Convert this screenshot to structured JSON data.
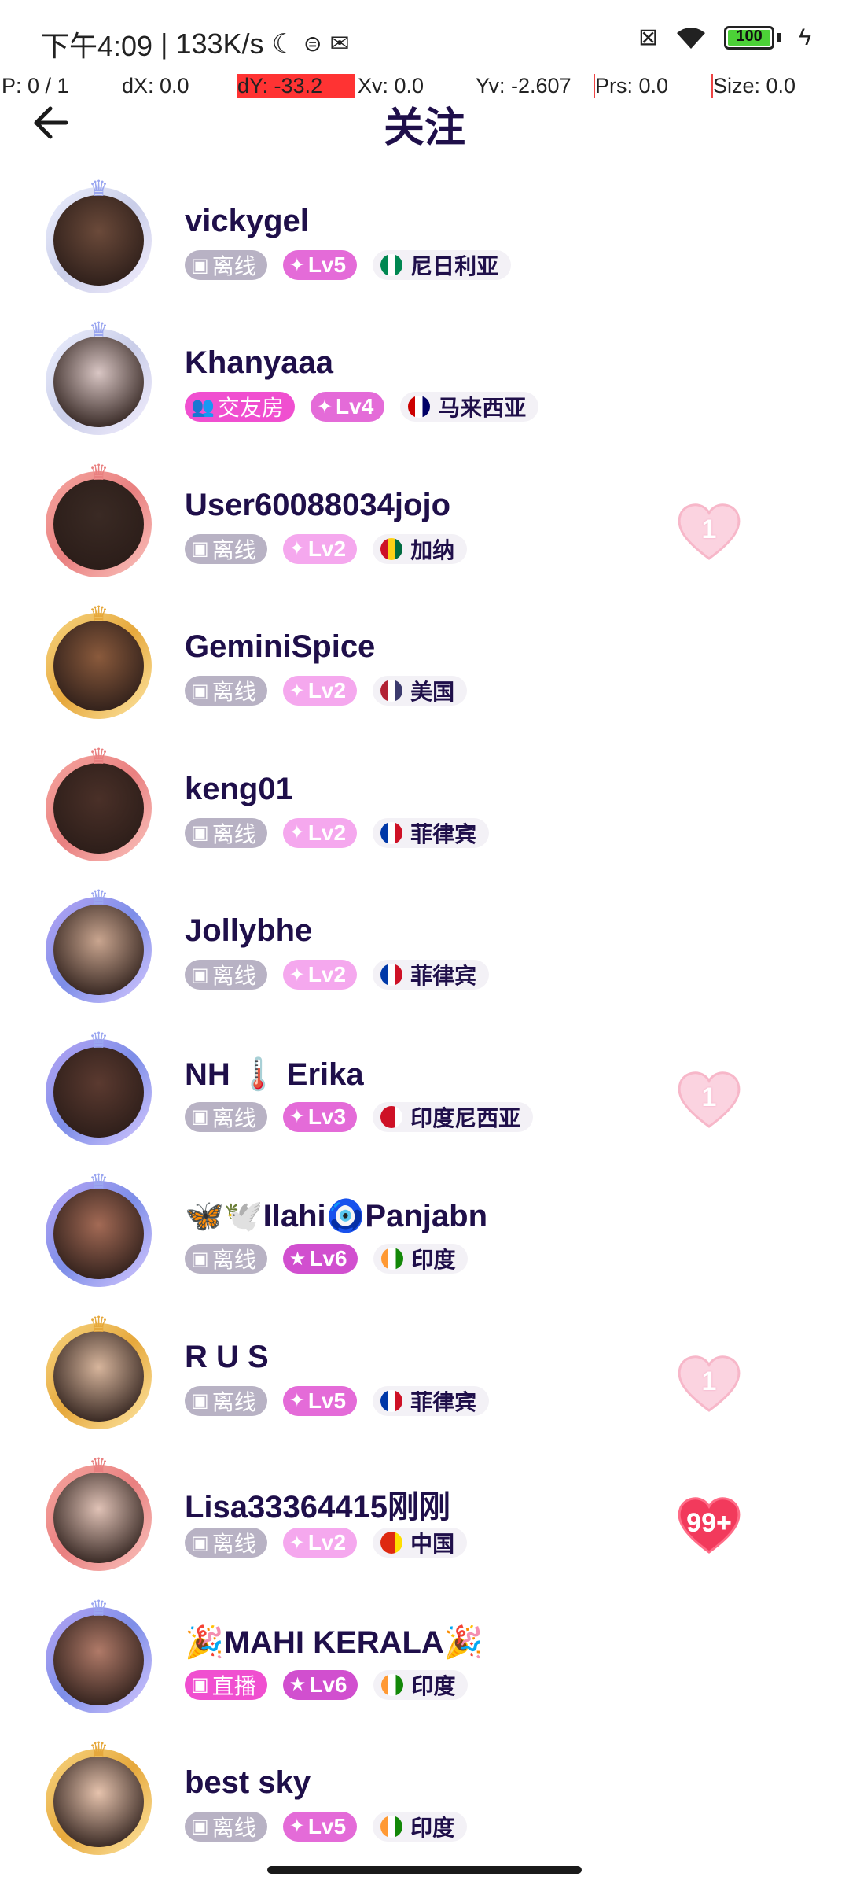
{
  "status_bar": {
    "time": "下午4:09",
    "separator": "|",
    "speed": "133K/s",
    "battery": "100",
    "battery_level": 1.0,
    "icons": [
      "moon-icon",
      "sim-icon",
      "mail-icon",
      "no-sim-icon",
      "wifi-icon",
      "battery-icon",
      "charging-icon"
    ]
  },
  "debug": {
    "p": "P: 0 / 1",
    "dx": "dX: 0.0",
    "dy": "dY: -33.2",
    "xv": "Xv: 0.0",
    "yv": "Yv: -2.607",
    "prs": "Prs: 0.0",
    "size": "Size: 0.0"
  },
  "header": {
    "title": "关注",
    "back_icon": "arrow-left-icon"
  },
  "colors": {
    "title": "#1f0f4a",
    "offline_tag": "#b8b2c4",
    "party_tag": "#f04fd0",
    "heart_light": "#fbd3e0",
    "heart_strong": "#f23a5c"
  },
  "users": [
    {
      "name": "vickygel",
      "status": "离线",
      "status_type": "offline",
      "level": "Lv5",
      "country": "尼日利亚",
      "flag_colors": [
        "#008751",
        "#ffffff",
        "#008751"
      ],
      "frame": "silver",
      "heart": ""
    },
    {
      "name": "Khanyaaa",
      "status": "交友房",
      "status_type": "party",
      "level": "Lv4",
      "country": "马来西亚",
      "flag_colors": [
        "#cc0000",
        "#ffffff",
        "#010066"
      ],
      "frame": "silver",
      "heart": ""
    },
    {
      "name": "User60088034jojo",
      "status": "离线",
      "status_type": "offline",
      "level": "Lv2",
      "country": "加纳",
      "flag_colors": [
        "#ce1126",
        "#fcd116",
        "#006b3f"
      ],
      "frame": "pink",
      "heart": "1"
    },
    {
      "name": "GeminiSpice",
      "status": "离线",
      "status_type": "offline",
      "level": "Lv2",
      "country": "美国",
      "flag_colors": [
        "#b22234",
        "#ffffff",
        "#3c3b6e"
      ],
      "frame": "gold",
      "heart": ""
    },
    {
      "name": "keng01",
      "status": "离线",
      "status_type": "offline",
      "level": "Lv2",
      "country": "菲律宾",
      "flag_colors": [
        "#0038a8",
        "#ffffff",
        "#ce1126"
      ],
      "frame": "pink",
      "heart": ""
    },
    {
      "name": "Jollybhe",
      "status": "离线",
      "status_type": "offline",
      "level": "Lv2",
      "country": "菲律宾",
      "flag_colors": [
        "#0038a8",
        "#ffffff",
        "#ce1126"
      ],
      "frame": "purple",
      "heart": ""
    },
    {
      "name": "NH 🌡️ Erika",
      "status": "离线",
      "status_type": "offline",
      "level": "Lv3",
      "country": "印度尼西亚",
      "flag_colors": [
        "#ce1126",
        "#ce1126",
        "#ffffff"
      ],
      "frame": "purple",
      "heart": "1"
    },
    {
      "name": "🦋🕊️Ilahi🧿Panjabn",
      "status": "离线",
      "status_type": "offline",
      "level": "Lv6",
      "country": "印度",
      "flag_colors": [
        "#ff9933",
        "#ffffff",
        "#138808"
      ],
      "frame": "purple",
      "heart": ""
    },
    {
      "name": "R U S",
      "status": "离线",
      "status_type": "offline",
      "level": "Lv5",
      "country": "菲律宾",
      "flag_colors": [
        "#0038a8",
        "#ffffff",
        "#ce1126"
      ],
      "frame": "gold",
      "heart": "1"
    },
    {
      "name": "Lisa33364415刚刚",
      "status": "离线",
      "status_type": "offline",
      "level": "Lv2",
      "country": "中国",
      "flag_colors": [
        "#de2910",
        "#de2910",
        "#ffde00"
      ],
      "frame": "pink",
      "heart": "99+"
    },
    {
      "name": "🎉MAHI KERALA🎉",
      "status": "直播",
      "status_type": "live",
      "level": "Lv6",
      "country": "印度",
      "flag_colors": [
        "#ff9933",
        "#ffffff",
        "#138808"
      ],
      "frame": "purple",
      "heart": ""
    },
    {
      "name": "best sky",
      "status": "离线",
      "status_type": "offline",
      "level": "Lv5",
      "country": "印度",
      "flag_colors": [
        "#ff9933",
        "#ffffff",
        "#138808"
      ],
      "frame": "gold",
      "heart": ""
    }
  ]
}
